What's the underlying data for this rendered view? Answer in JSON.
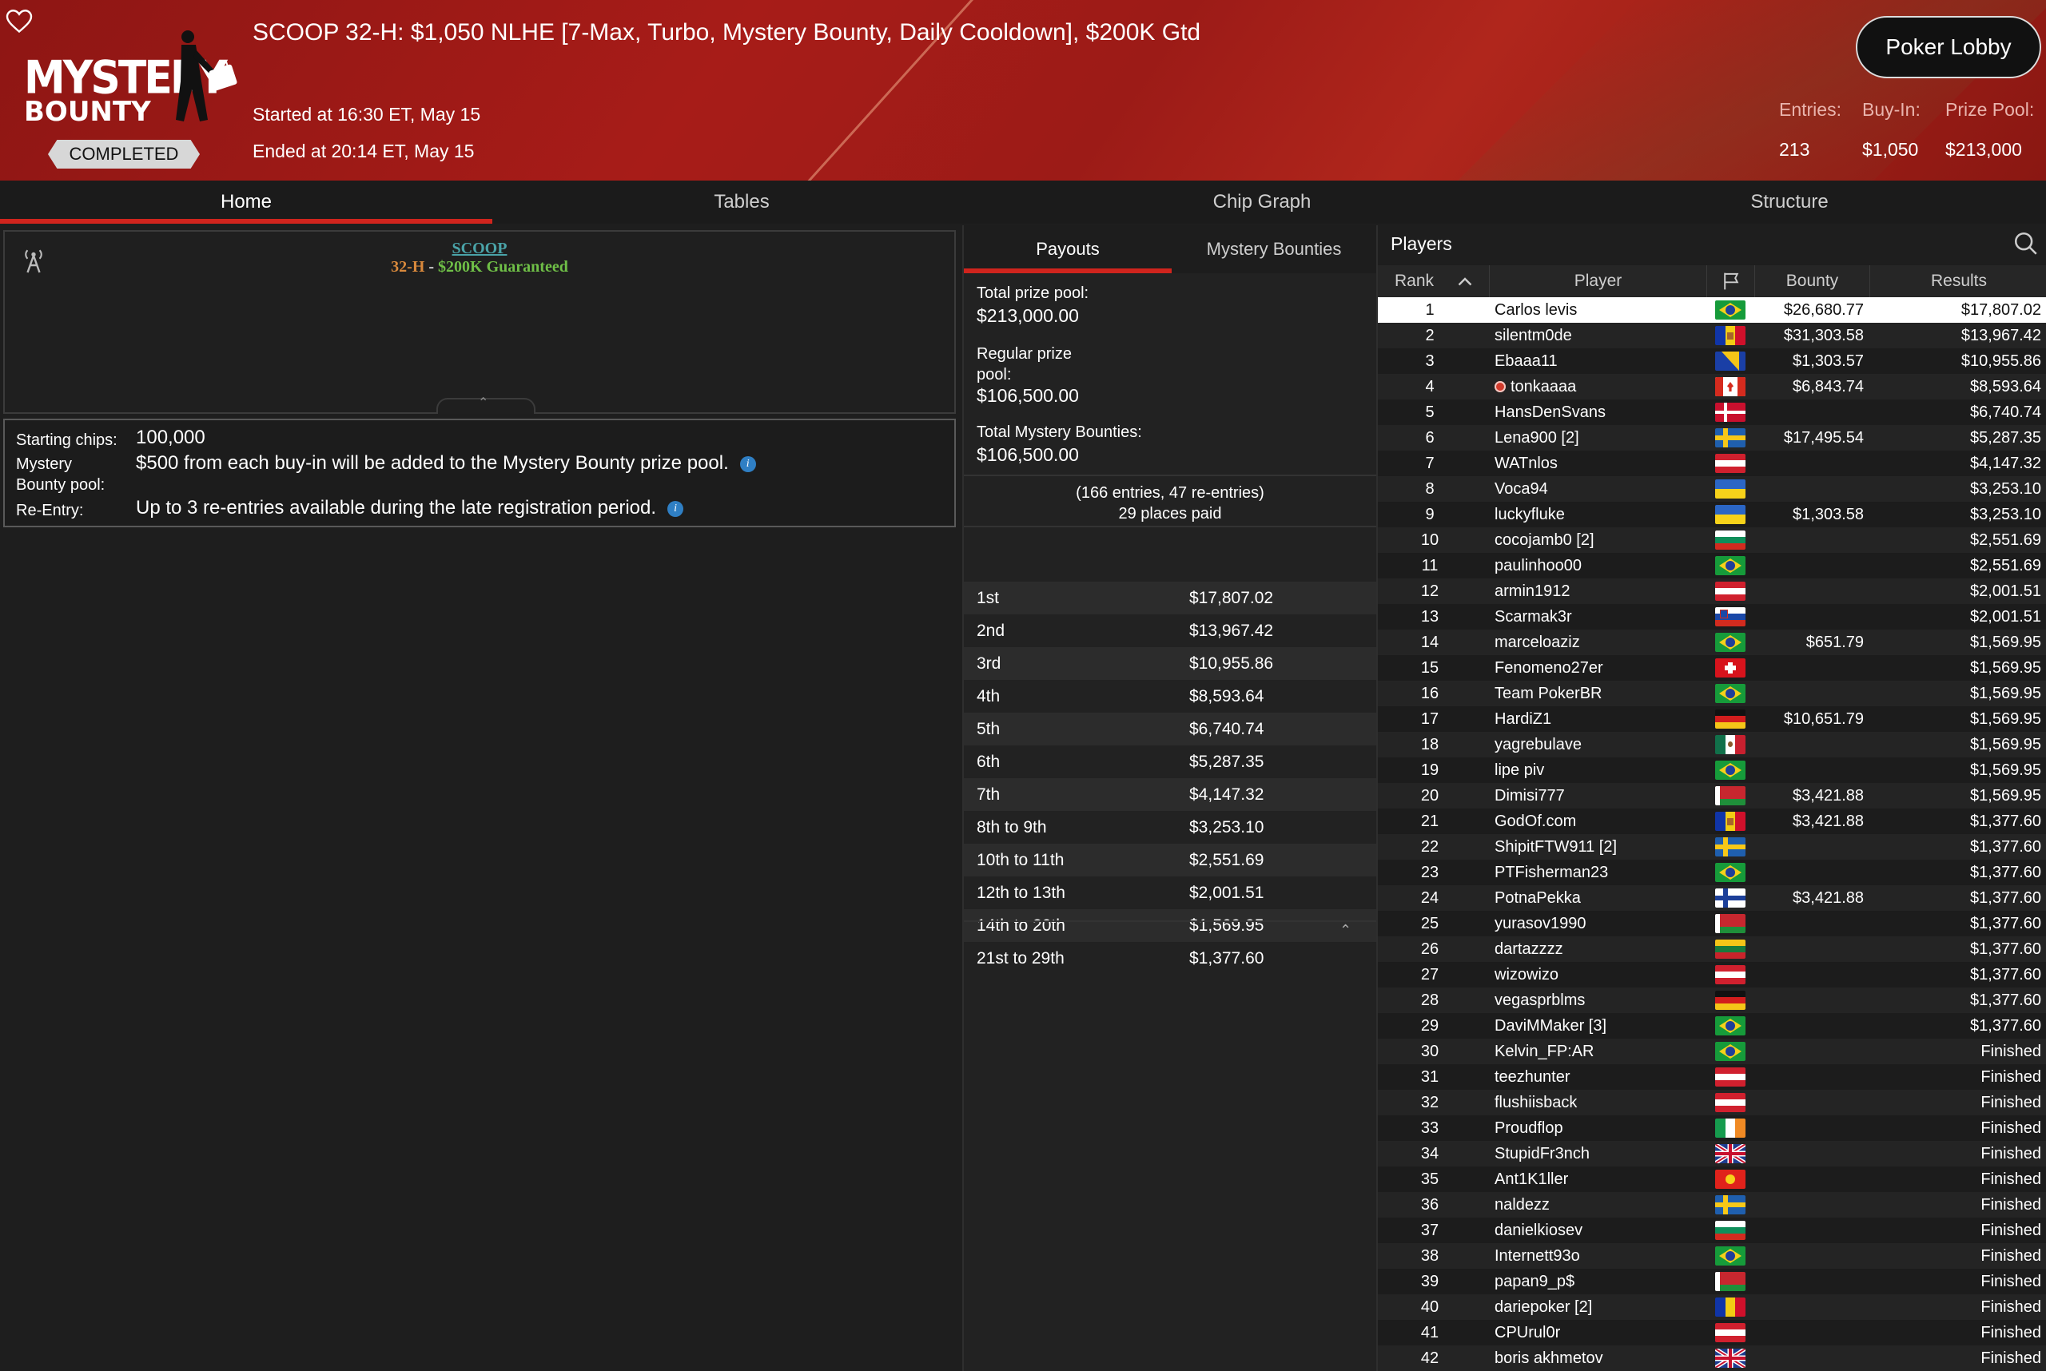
{
  "header": {
    "title": "SCOOP 32-H: $1,050 NLHE [7-Max, Turbo, Mystery Bounty, Daily Cooldown], $200K Gtd",
    "started": "Started at 16:30 ET, May 15",
    "ended": "Ended at 20:14 ET, May 15",
    "status": "COMPLETED",
    "logo_line1": "MYSTERY",
    "logo_line2": "BOUNTY",
    "lobby_button": "Poker Lobby",
    "stats": {
      "entries_label": "Entries:",
      "entries_value": "213",
      "buyin_label": "Buy-In:",
      "buyin_value": "$1,050",
      "prizepool_label": "Prize Pool:",
      "prizepool_value": "$213,000"
    }
  },
  "tabs": [
    "Home",
    "Tables",
    "Chip Graph",
    "Structure"
  ],
  "home": {
    "banner_series": "SCOOP",
    "banner_event": "32-H",
    "banner_dash": " - ",
    "banner_gtd": "$200K Guaranteed",
    "starting_chips_label": "Starting chips:",
    "starting_chips_value": "100,000",
    "mystery_label": "Mystery Bounty pool:",
    "mystery_value": "$500 from each buy-in will be added to the Mystery Bounty prize pool.",
    "reentry_label": "Re-Entry:",
    "reentry_value": "Up to 3 re-entries available during the late registration period.",
    "info_glyph": "i"
  },
  "payouts": {
    "tabs": [
      "Payouts",
      "Mystery Bounties"
    ],
    "total_label": "Total prize pool:",
    "total_value": "$213,000.00",
    "regular_label": "Regular prize pool:",
    "regular_value": "$106,500.00",
    "bounties_label": "Total Mystery Bounties:",
    "bounties_value": "$106,500.00",
    "entries_line1": "(166 entries, 47 re-entries)",
    "entries_line2": "29 places paid",
    "rows": [
      {
        "place": "1st",
        "amount": "$17,807.02"
      },
      {
        "place": "2nd",
        "amount": "$13,967.42"
      },
      {
        "place": "3rd",
        "amount": "$10,955.86"
      },
      {
        "place": "4th",
        "amount": "$8,593.64"
      },
      {
        "place": "5th",
        "amount": "$6,740.74"
      },
      {
        "place": "6th",
        "amount": "$5,287.35"
      },
      {
        "place": "7th",
        "amount": "$4,147.32"
      },
      {
        "place": "8th to 9th",
        "amount": "$3,253.10"
      },
      {
        "place": "10th to 11th",
        "amount": "$2,551.69"
      },
      {
        "place": "12th to 13th",
        "amount": "$2,001.51"
      },
      {
        "place": "14th to 20th",
        "amount": "$1,569.95"
      },
      {
        "place": "21st to 29th",
        "amount": "$1,377.60"
      }
    ]
  },
  "players": {
    "title": "Players",
    "columns": {
      "rank": "Rank",
      "player": "Player",
      "bounty": "Bounty",
      "results": "Results"
    },
    "rows": [
      {
        "rank": "1",
        "name": "Carlos levis",
        "flag": "br",
        "bounty": "$26,680.77",
        "result": "$17,807.02"
      },
      {
        "rank": "2",
        "name": "silentm0de",
        "flag": "ad",
        "bounty": "$31,303.58",
        "result": "$13,967.42"
      },
      {
        "rank": "3",
        "name": "Ebaaa11",
        "flag": "ba",
        "bounty": "$1,303.57",
        "result": "$10,955.86"
      },
      {
        "rank": "4",
        "name": "tonkaaaa",
        "flag": "ca",
        "bounty": "$6,843.74",
        "result": "$8,593.64"
      },
      {
        "rank": "5",
        "name": "HansDenSvans",
        "flag": "dk",
        "bounty": "",
        "result": "$6,740.74"
      },
      {
        "rank": "6",
        "name": "Lena900 [2]",
        "flag": "se",
        "bounty": "$17,495.54",
        "result": "$5,287.35"
      },
      {
        "rank": "7",
        "name": "WATnlos",
        "flag": "at",
        "bounty": "",
        "result": "$4,147.32"
      },
      {
        "rank": "8",
        "name": "Voca94",
        "flag": "ua",
        "bounty": "",
        "result": "$3,253.10"
      },
      {
        "rank": "9",
        "name": "luckyfluke",
        "flag": "ua",
        "bounty": "$1,303.58",
        "result": "$3,253.10"
      },
      {
        "rank": "10",
        "name": "cocojamb0 [2]",
        "flag": "bg",
        "bounty": "",
        "result": "$2,551.69"
      },
      {
        "rank": "11",
        "name": "paulinhoo00",
        "flag": "br",
        "bounty": "",
        "result": "$2,551.69"
      },
      {
        "rank": "12",
        "name": "armin1912",
        "flag": "at",
        "bounty": "",
        "result": "$2,001.51"
      },
      {
        "rank": "13",
        "name": "Scarmak3r",
        "flag": "si",
        "bounty": "",
        "result": "$2,001.51"
      },
      {
        "rank": "14",
        "name": "marceloaziz",
        "flag": "br",
        "bounty": "$651.79",
        "result": "$1,569.95"
      },
      {
        "rank": "15",
        "name": "Fenomeno27er",
        "flag": "ch",
        "bounty": "",
        "result": "$1,569.95"
      },
      {
        "rank": "16",
        "name": "Team PokerBR",
        "flag": "br",
        "bounty": "",
        "result": "$1,569.95"
      },
      {
        "rank": "17",
        "name": "HardiZ1",
        "flag": "de",
        "bounty": "$10,651.79",
        "result": "$1,569.95"
      },
      {
        "rank": "18",
        "name": "yagrebulave",
        "flag": "mx",
        "bounty": "",
        "result": "$1,569.95"
      },
      {
        "rank": "19",
        "name": "lipe piv",
        "flag": "br",
        "bounty": "",
        "result": "$1,569.95"
      },
      {
        "rank": "20",
        "name": "Dimisi777",
        "flag": "by",
        "bounty": "$3,421.88",
        "result": "$1,569.95"
      },
      {
        "rank": "21",
        "name": "GodOf.com",
        "flag": "ad",
        "bounty": "$3,421.88",
        "result": "$1,377.60"
      },
      {
        "rank": "22",
        "name": "ShipitFTW911 [2]",
        "flag": "se",
        "bounty": "",
        "result": "$1,377.60"
      },
      {
        "rank": "23",
        "name": "PTFisherman23",
        "flag": "br",
        "bounty": "",
        "result": "$1,377.60"
      },
      {
        "rank": "24",
        "name": "PotnaPekka",
        "flag": "fi",
        "bounty": "$3,421.88",
        "result": "$1,377.60"
      },
      {
        "rank": "25",
        "name": "yurasov1990",
        "flag": "by",
        "bounty": "",
        "result": "$1,377.60"
      },
      {
        "rank": "26",
        "name": "dartazzzz",
        "flag": "lt",
        "bounty": "",
        "result": "$1,377.60"
      },
      {
        "rank": "27",
        "name": "wizowizo",
        "flag": "at",
        "bounty": "",
        "result": "$1,377.60"
      },
      {
        "rank": "28",
        "name": "vegasprblms",
        "flag": "de",
        "bounty": "",
        "result": "$1,377.60"
      },
      {
        "rank": "29",
        "name": "DaviMMaker [3]",
        "flag": "br",
        "bounty": "",
        "result": "$1,377.60"
      },
      {
        "rank": "30",
        "name": "Kelvin_FP:AR",
        "flag": "br",
        "bounty": "",
        "result": "Finished"
      },
      {
        "rank": "31",
        "name": "teezhunter",
        "flag": "at",
        "bounty": "",
        "result": "Finished"
      },
      {
        "rank": "32",
        "name": "flushiisback",
        "flag": "at",
        "bounty": "",
        "result": "Finished"
      },
      {
        "rank": "33",
        "name": "Proudflop",
        "flag": "ie",
        "bounty": "",
        "result": "Finished"
      },
      {
        "rank": "34",
        "name": "StupidFr3nch",
        "flag": "gb",
        "bounty": "",
        "result": "Finished"
      },
      {
        "rank": "35",
        "name": "Ant1K1ller",
        "flag": "kg",
        "bounty": "",
        "result": "Finished"
      },
      {
        "rank": "36",
        "name": "naldezz",
        "flag": "se",
        "bounty": "",
        "result": "Finished"
      },
      {
        "rank": "37",
        "name": "danielkiosev",
        "flag": "bg",
        "bounty": "",
        "result": "Finished"
      },
      {
        "rank": "38",
        "name": "Internett93o",
        "flag": "br",
        "bounty": "",
        "result": "Finished"
      },
      {
        "rank": "39",
        "name": "papan9_p$",
        "flag": "by",
        "bounty": "",
        "result": "Finished"
      },
      {
        "rank": "40",
        "name": "dariepoker [2]",
        "flag": "ro",
        "bounty": "",
        "result": "Finished"
      },
      {
        "rank": "41",
        "name": "CPUrul0r",
        "flag": "at",
        "bounty": "",
        "result": "Finished"
      },
      {
        "rank": "42",
        "name": "boris akhmetov",
        "flag": "gb",
        "bounty": "",
        "result": "Finished"
      }
    ]
  },
  "colors": {
    "accent": "#d0241d",
    "header_red": "#a71c18",
    "background": "#1e1e1e",
    "info_blue": "#2f7fc4"
  }
}
